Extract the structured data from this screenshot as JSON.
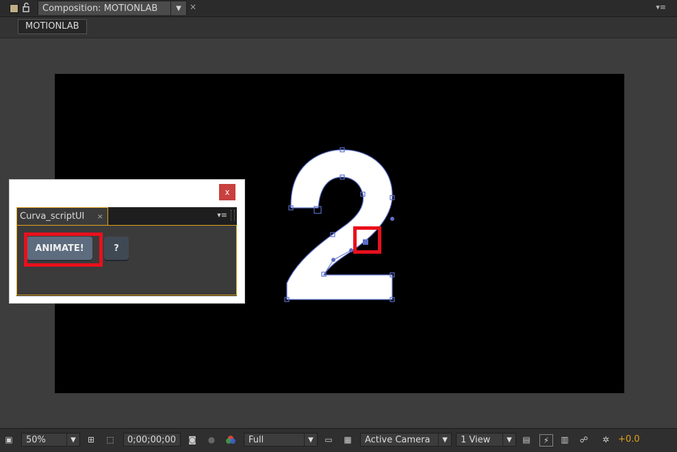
{
  "tabbar": {
    "composition_tab": "Composition: MOTIONLAB",
    "breadcrumb": "MOTIONLAB",
    "close_glyph": "×",
    "menu_glyph": "▾≡"
  },
  "canvas": {
    "digit_text": "2"
  },
  "script_window": {
    "close_label": "x",
    "panel_tab": "Curva_scriptUI",
    "panel_tab_close": "×",
    "panel_menu": "▾≡",
    "animate_button": "ANIMATE!",
    "help_button": "?"
  },
  "toolbar": {
    "zoom": "50%",
    "timecode": "0;00;00;00",
    "resolution": "Full",
    "camera": "Active Camera",
    "views": "1 View",
    "exposure": "+0.0"
  },
  "colors": {
    "highlight": "#e8101c",
    "panel_border": "#e3a41d",
    "exposure": "#e0a21b",
    "path": "#5b6fc9"
  },
  "icons": [
    "lock-icon",
    "snapshot-icon",
    "show-channel-icon",
    "transparency-grid-icon",
    "region-of-interest-icon",
    "fast-preview-icon",
    "flowchart-icon"
  ]
}
